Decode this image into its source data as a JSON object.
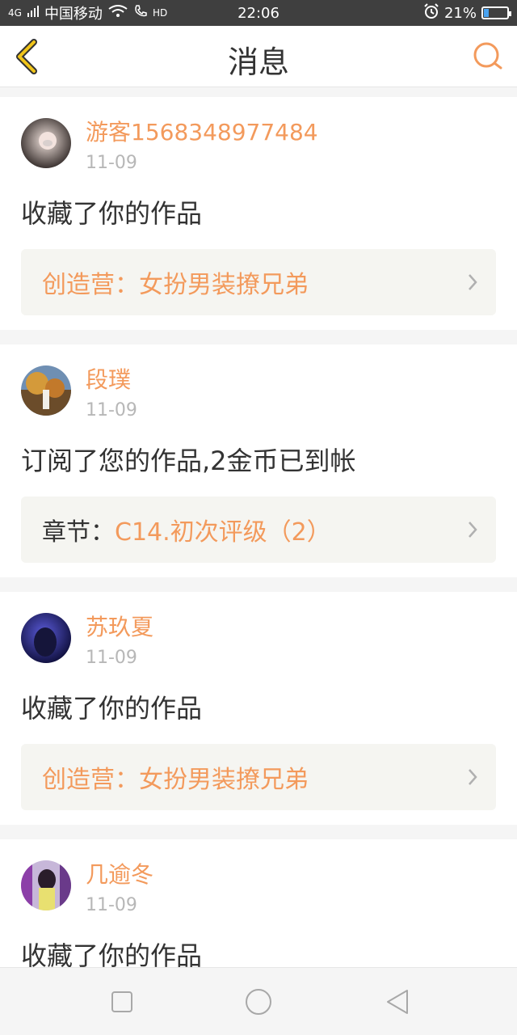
{
  "status_bar": {
    "network": "4G",
    "carrier": "中国移动",
    "hd": "HD",
    "time": "22:06",
    "battery_percent": "21%"
  },
  "header": {
    "title": "消息",
    "back_icon": "chevron-left-icon",
    "search_icon": "search-icon"
  },
  "colors": {
    "accent": "#f39a5c",
    "back_arrow": "#f0c419",
    "link_bg": "#f5f5f1"
  },
  "messages": [
    {
      "name": "游客1568348977484",
      "date": "11-09",
      "action": "收藏了你的作品",
      "link_label": "",
      "link_value": "创造营：女扮男装撩兄弟"
    },
    {
      "name": "段璞",
      "date": "11-09",
      "action": "订阅了您的作品,2金币已到帐",
      "link_label": "章节：",
      "link_value": "C14.初次评级（2）"
    },
    {
      "name": "苏玖夏",
      "date": "11-09",
      "action": "收藏了你的作品",
      "link_label": "",
      "link_value": "创造营：女扮男装撩兄弟"
    },
    {
      "name": "几逾冬",
      "date": "11-09",
      "action": "收藏了你的作品"
    }
  ],
  "navbar": {
    "recent_icon": "square-icon",
    "home_icon": "circle-icon",
    "back_icon": "triangle-back-icon"
  }
}
